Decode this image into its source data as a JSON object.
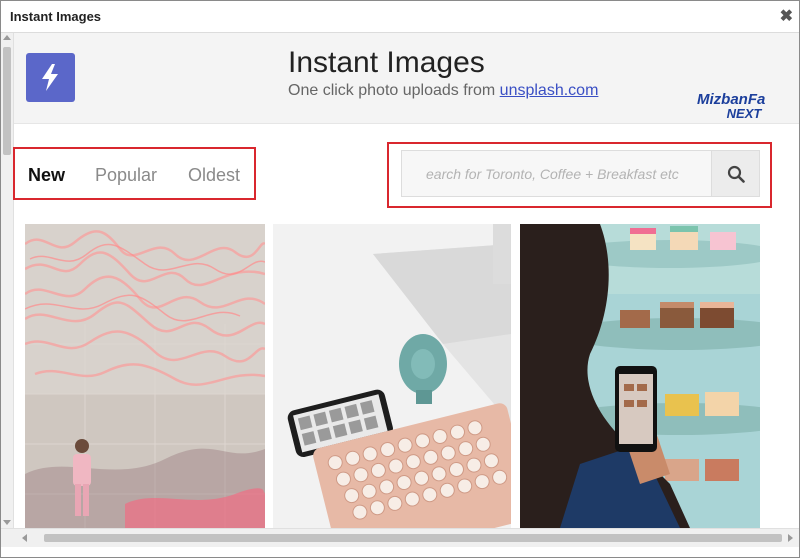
{
  "window": {
    "title": "Instant Images",
    "close_label": "✖"
  },
  "header": {
    "app_title": "Instant Images",
    "tagline_prefix": "One click photo uploads from ",
    "tagline_link": "unsplash.com",
    "brand_line1": "MizbanFa",
    "brand_line2": "NEXT",
    "logo_icon": "lightning-bolt-icon"
  },
  "tabs": [
    {
      "label": "New",
      "active": true
    },
    {
      "label": "Popular",
      "active": false
    },
    {
      "label": "Oldest",
      "active": false
    }
  ],
  "search": {
    "placeholder": "earch for Toronto, Coffee + Breakfast etc",
    "button_icon": "search-icon"
  },
  "photos": [
    {
      "subject": "neon-wall-woman-photo"
    },
    {
      "subject": "desk-keyboard-phone-photo"
    },
    {
      "subject": "phone-cakes-photo"
    }
  ],
  "colors": {
    "logo_bg": "#5b67c9",
    "highlight_border": "#d9272e",
    "link": "#3a4fc4"
  }
}
